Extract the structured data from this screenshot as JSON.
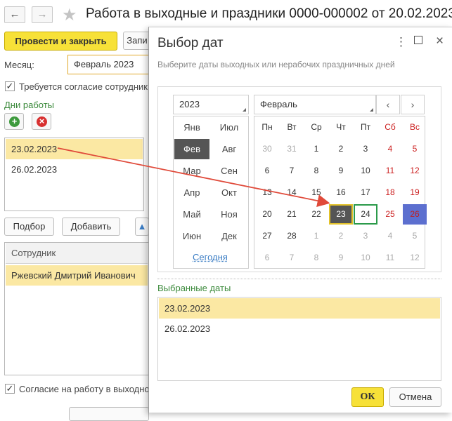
{
  "main": {
    "title": "Работа в выходные и праздники 0000-000002 от 20.02.2023",
    "buttons": {
      "post_close": "Провести и закрыть",
      "write_partial": "Запи",
      "pick": "Подбор",
      "add": "Добавить"
    },
    "month_label": "Месяц:",
    "month_value": "Февраль 2023",
    "consent_required": "Требуется согласие сотрудник",
    "work_days_label": "Дни работы",
    "work_days": [
      "23.02.2023",
      "26.02.2023"
    ],
    "employee_header": "Сотрудник",
    "employees": [
      "Ржевский Дмитрий Иванович"
    ],
    "consent_bottom": "Согласие на работу в выходно"
  },
  "dialog": {
    "title": "Выбор дат",
    "hint": "Выберите даты выходных или нерабочих праздничных дней",
    "year": "2023",
    "month": "Февраль",
    "months": [
      [
        "Янв",
        "Июл"
      ],
      [
        "Фев",
        "Авг"
      ],
      [
        "Мар",
        "Сен"
      ],
      [
        "Апр",
        "Окт"
      ],
      [
        "Май",
        "Ноя"
      ],
      [
        "Июн",
        "Дек"
      ]
    ],
    "selected_month": "Фев",
    "today_link": "Сегодня",
    "weekdays": [
      "Пн",
      "Вт",
      "Ср",
      "Чт",
      "Пт",
      "Сб",
      "Вс"
    ],
    "weeks": [
      [
        "30",
        "31",
        "1",
        "2",
        "3",
        "4",
        "5"
      ],
      [
        "6",
        "7",
        "8",
        "9",
        "10",
        "11",
        "12"
      ],
      [
        "13",
        "14",
        "15",
        "16",
        "17",
        "18",
        "19"
      ],
      [
        "20",
        "21",
        "22",
        "23",
        "24",
        "25",
        "26"
      ],
      [
        "27",
        "28",
        "1",
        "2",
        "3",
        "4",
        "5"
      ],
      [
        "6",
        "7",
        "8",
        "9",
        "10",
        "11",
        "12"
      ]
    ],
    "selected_label": "Выбранные даты",
    "selected_dates": [
      "23.02.2023",
      "26.02.2023"
    ],
    "ok": "ОК",
    "cancel": "Отмена"
  },
  "colors": {
    "accent_yellow": "#f7e138",
    "weekend_red": "#cc2222",
    "label_green": "#3b8a3b",
    "selection_row": "#fbe8a3",
    "arrow_red": "#e04a3a"
  }
}
